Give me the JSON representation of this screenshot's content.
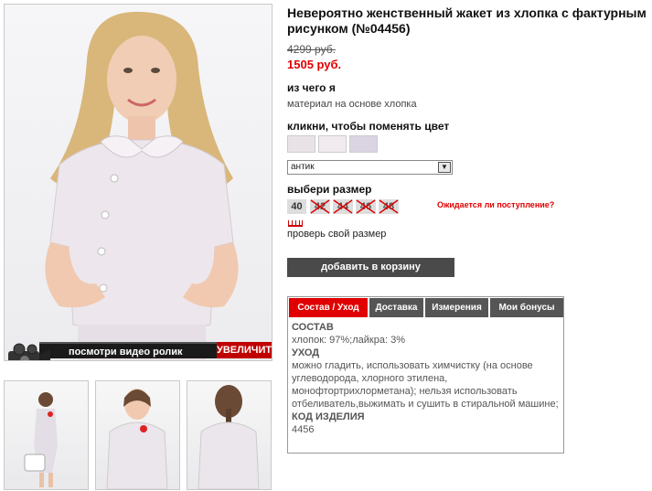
{
  "product": {
    "title": "Невероятно женственный жакет из хлопка с фактурным рисунком (№04456)",
    "old_price": "4299 руб.",
    "new_price": "1505 руб."
  },
  "material": {
    "heading": "из чего я",
    "text": "материал на основе хлопка"
  },
  "color": {
    "heading": "кликни, чтобы поменять цвет",
    "swatches": [
      "#e9e3e8",
      "#f1ebf0",
      "#dad4e2"
    ],
    "selected": "антик"
  },
  "size": {
    "heading": "выбери размер",
    "available": "40",
    "unavailable": [
      "42",
      "44",
      "46",
      "48"
    ],
    "waiting_link": "Ожидается ли поступление?",
    "check_link": "проверь свой размер"
  },
  "cart": {
    "button": "добавить в корзину"
  },
  "media": {
    "video_label": "посмотри видео ролик",
    "zoom_label": "УВЕЛИЧИТЬ"
  },
  "tabs": [
    {
      "label": "Состав / Уход",
      "active": true
    },
    {
      "label": "Доставка",
      "active": false
    },
    {
      "label": "Измерения",
      "active": false
    },
    {
      "label": "Мои бонусы",
      "active": false
    }
  ],
  "details": {
    "composition_head": "СОСТАВ",
    "composition": "хлопок: 97%;лайкра: 3%",
    "care_head": "УХОД",
    "care": "можно гладить, использовать химчистку (на основе углеводорода, хлорного этилена, монофтортрихлорметана); нельзя использовать отбеливатель,выжимать и сушить в стиральной машине;",
    "code_head": "КОД ИЗДЕЛИЯ",
    "code": "4456"
  },
  "colors": {
    "accent": "#e00000",
    "button": "#4a4a4a",
    "tab": "#555555"
  }
}
